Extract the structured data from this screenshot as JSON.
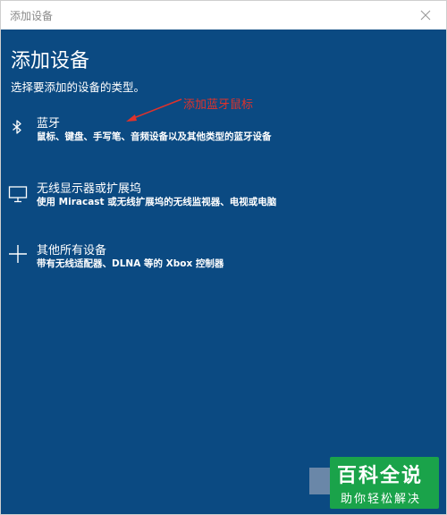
{
  "window": {
    "title": "添加设备"
  },
  "main": {
    "heading": "添加设备",
    "subheading": "选择要添加的设备的类型。"
  },
  "annotation": {
    "text": "添加蓝牙鼠标",
    "color": "#e0322b"
  },
  "options": [
    {
      "icon": "bluetooth-icon",
      "title": "蓝牙",
      "description": "鼠标、键盘、手写笔、音频设备以及其他类型的蓝牙设备"
    },
    {
      "icon": "monitor-icon",
      "title": "无线显示器或扩展坞",
      "description": "使用 Miracast 或无线扩展坞的无线监视器、电视或电脑"
    },
    {
      "icon": "plus-icon",
      "title": "其他所有设备",
      "description": "带有无线适配器、DLNA 等的 Xbox 控制器"
    }
  ],
  "watermark": {
    "main": "百科全说",
    "sub": "助你轻松解决"
  },
  "colors": {
    "background": "#0b4a82",
    "accent": "#1aa34a"
  }
}
